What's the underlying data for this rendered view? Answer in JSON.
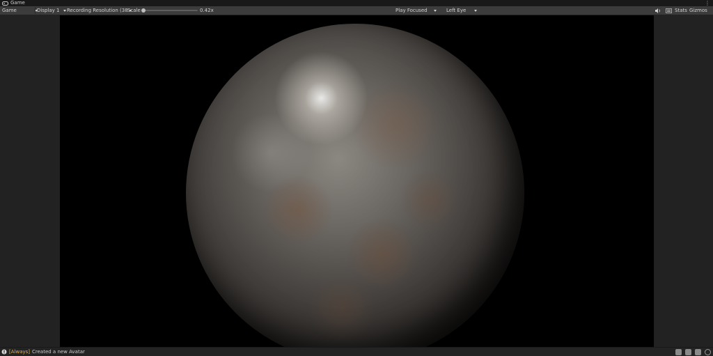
{
  "window": {
    "tab_title": "Game",
    "tab_icon": "gamepad-icon",
    "menu_icon": "kebab-menu-icon"
  },
  "toolbar": {
    "view_mode": "Game",
    "display": "Display 1",
    "resolution": "Recording Resolution (38",
    "scale_label": "Scale",
    "scale_value": "0.42x",
    "scale_level": 0.05,
    "play_mode": "Play Focused",
    "eye": "Left Eye",
    "audio_icon": "speaker-icon",
    "stats_icon": "stats-icon",
    "stats_label": "Stats",
    "gizmos_label": "Gizmos"
  },
  "viewport": {
    "background": "#000000",
    "object": "textured-sphere"
  },
  "status": {
    "icon": "info-icon",
    "tag": "[Always]",
    "message": "Created a new Avatar",
    "right_icons": [
      "network-icon",
      "database-icon",
      "code-icon",
      "check-circle-icon"
    ]
  },
  "colors": {
    "toolbar_bg": "#3c3c3c",
    "panel_bg": "#222222",
    "warning": "#e6b53e"
  }
}
